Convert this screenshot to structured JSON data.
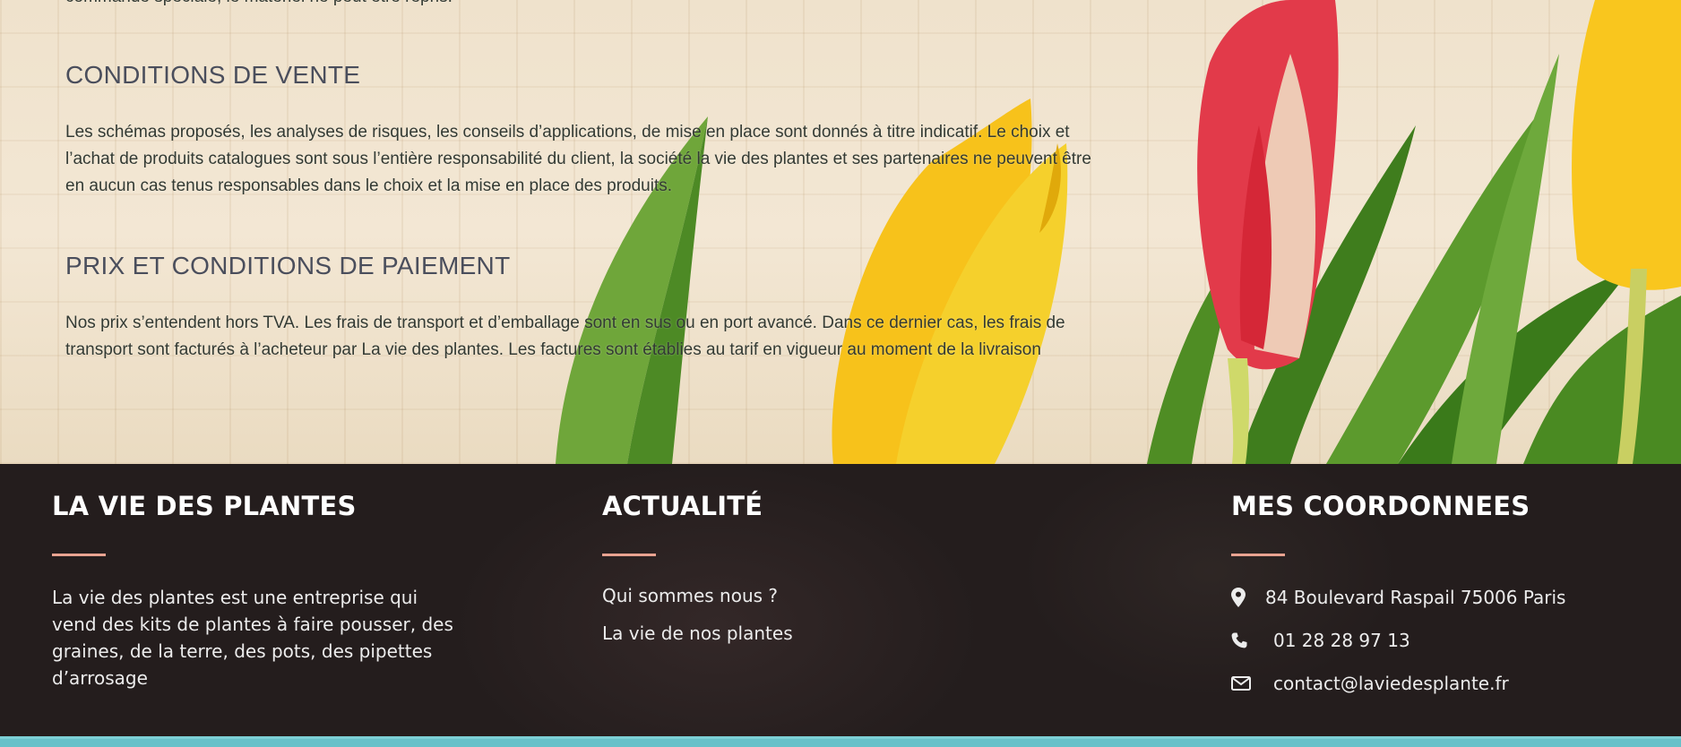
{
  "content": {
    "return_text": "commande spéciale, le matériel ne peut être repris.",
    "conditions_vente": {
      "heading": "CONDITIONS DE VENTE",
      "text": "Les  schémas proposés, les analyses de risques, les conseils d’applications, de mise en place sont donnés à titre indicatif. Le choix et l’achat de produits catalogues sont sous l’entière responsabilité du client, la société la vie des plantes et ses partenaires ne peuvent être en aucun cas tenus responsables dans le choix et la mise en place des produits."
    },
    "prix": {
      "heading": "PRIX ET CONDITIONS DE PAIEMENT",
      "text": "Nos prix s’entendent hors TVA. Les frais de transport et d’emballage sont en sus ou en port avancé. Dans ce dernier cas, les frais de transport sont facturés à l’acheteur par La vie des plantes. Les factures sont établies au tarif en vigueur au moment de la livraison"
    }
  },
  "footer": {
    "about": {
      "title": "LA VIE DES PLANTES",
      "text": "La vie des plantes est une entreprise qui vend des kits de plantes à faire pousser, des graines, de la terre, des pots, des pipettes d’arrosage"
    },
    "news": {
      "title": "ACTUALITÉ",
      "links": [
        "Qui sommes nous ?",
        "La vie de nos plantes"
      ]
    },
    "contact": {
      "title": "MES COORDONNEES",
      "items": [
        {
          "icon": "map-marker-icon",
          "text": "84 Boulevard Raspail 75006 Paris"
        },
        {
          "icon": "phone-icon",
          "text": "01 28 28 97 13"
        },
        {
          "icon": "envelope-icon",
          "text": "contact@laviedesplante.fr"
        }
      ]
    },
    "accent_color": "#e9a391",
    "background_color": "#241d1d",
    "stripe_color": "#67c1c9"
  }
}
